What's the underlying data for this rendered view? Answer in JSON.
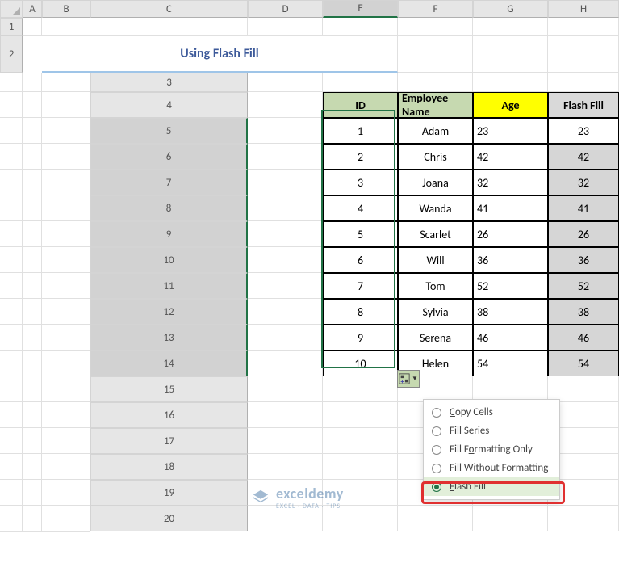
{
  "cols": [
    "A",
    "B",
    "C",
    "D",
    "E",
    "F",
    "G",
    "H"
  ],
  "rows": [
    "1",
    "2",
    "3",
    "4",
    "5",
    "6",
    "7",
    "8",
    "9",
    "10",
    "11",
    "12",
    "13",
    "14",
    "15",
    "16",
    "17",
    "18",
    "19",
    "20"
  ],
  "title": "Using Flash Fill",
  "headers": {
    "id": "ID",
    "name": "Employee Name",
    "age": "Age",
    "ff": "Flash Fill"
  },
  "data": [
    {
      "id": "1",
      "name": "Adam",
      "age": "23",
      "ff": "23"
    },
    {
      "id": "2",
      "name": "Chris",
      "age": "42",
      "ff": "42"
    },
    {
      "id": "3",
      "name": "Joana",
      "age": "32",
      "ff": "32"
    },
    {
      "id": "4",
      "name": "Wanda",
      "age": "41",
      "ff": "41"
    },
    {
      "id": "5",
      "name": "Scarlet",
      "age": "26",
      "ff": "26"
    },
    {
      "id": "6",
      "name": "Will",
      "age": "36",
      "ff": "36"
    },
    {
      "id": "7",
      "name": "Tom",
      "age": "52",
      "ff": "52"
    },
    {
      "id": "8",
      "name": "Sylvia",
      "age": "38",
      "ff": "38"
    },
    {
      "id": "9",
      "name": "Serena",
      "age": "46",
      "ff": "46"
    },
    {
      "id": "10",
      "name": "Helen",
      "age": "54",
      "ff": "54"
    }
  ],
  "menu": {
    "copy": "Copy Cells",
    "series": "Fill Series",
    "fmt": "Fill Formatting Only",
    "nofmt": "Fill Without Formatting",
    "flash": "Flash Fill"
  },
  "watermark": {
    "brand": "exceldemy",
    "tagline": "EXCEL · DATA · TIPS"
  }
}
